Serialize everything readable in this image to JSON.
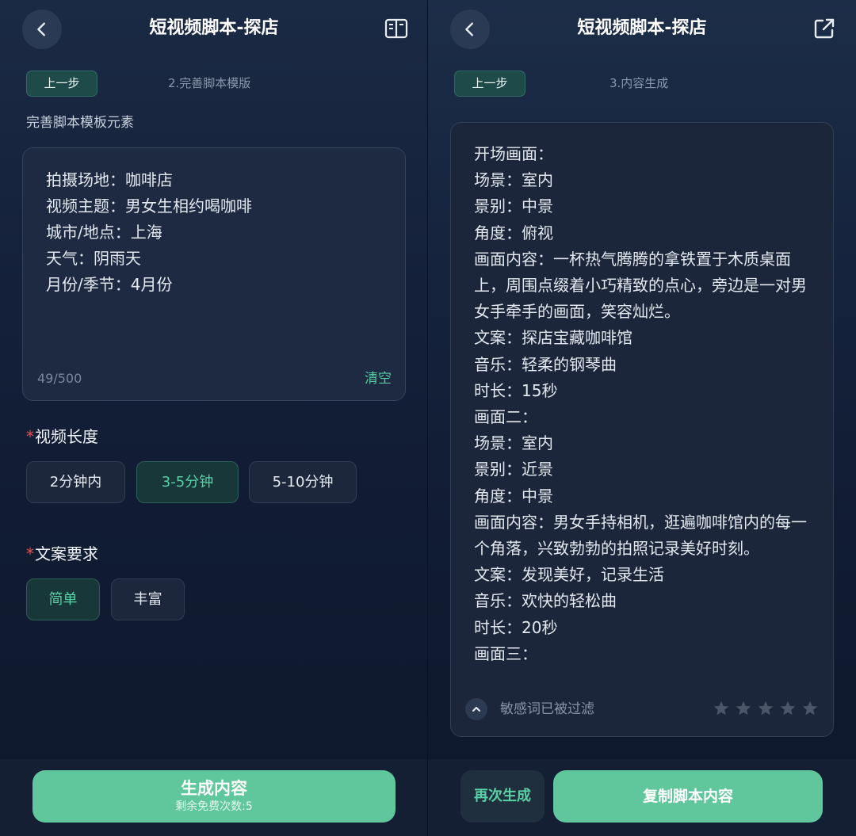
{
  "left": {
    "header": {
      "title": "短视频脚本-探店",
      "back_icon": "chevron-left-icon",
      "right_icon": "book-icon"
    },
    "prev_button": "上一步",
    "step": "2.完善脚本模版",
    "section_caption": "完善脚本模板元素",
    "input": {
      "lines": [
        "拍摄场地：咖啡店",
        "视频主题：男女生相约喝咖啡",
        "城市/地点：上海",
        "天气：阴雨天",
        "月份/季节：4月份"
      ],
      "counter": "49/500",
      "clear_label": "清空"
    },
    "video_length": {
      "required_mark": "*",
      "title": "视频长度",
      "options": [
        "2分钟内",
        "3-5分钟",
        "5-10分钟"
      ],
      "selected": "3-5分钟"
    },
    "copy_requirement": {
      "required_mark": "*",
      "title": "文案要求",
      "options": [
        "简单",
        "丰富"
      ],
      "selected": "简单"
    },
    "generate": {
      "label": "生成内容",
      "sub": "剩余免费次数:5"
    }
  },
  "right": {
    "header": {
      "title": "短视频脚本-探店",
      "back_icon": "chevron-left-icon",
      "right_icon": "share-icon"
    },
    "prev_button": "上一步",
    "step": "3.内容生成",
    "result_lines": [
      "开场画面：",
      "场景：室内",
      "景别：中景",
      "角度：俯视",
      "画面内容：一杯热气腾腾的拿铁置于木质桌面上，周围点缀着小巧精致的点心，旁边是一对男女手牵手的画面，笑容灿烂。",
      "文案：探店宝藏咖啡馆",
      "音乐：轻柔的钢琴曲",
      "时长：15秒",
      "画面二：",
      "场景：室内",
      "景别：近景",
      "角度：中景",
      "画面内容：男女手持相机，逛遍咖啡馆内的每一个角落，兴致勃勃的拍照记录美好时刻。",
      "文案：发现美好，记录生活",
      "音乐：欢快的轻松曲",
      "时长：20秒",
      "画面三："
    ],
    "filter_note": "敏感词已被过滤",
    "rating": {
      "max": 5,
      "value": 0
    },
    "regenerate_label": "再次生成",
    "copy_label": "复制脚本内容"
  },
  "colors": {
    "accent": "#5fc79b",
    "selected_text": "#5ad0a6",
    "required": "#e5534b"
  }
}
